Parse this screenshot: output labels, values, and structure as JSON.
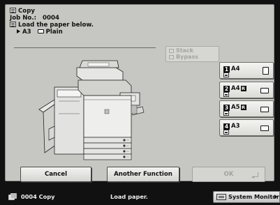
{
  "header": {
    "mode": "Copy",
    "job_label": "Job No.:",
    "job_number": "0004",
    "instruction": "Load the paper below.",
    "paper_size": "A3",
    "paper_type": "Plain"
  },
  "stack_bypass": {
    "line1": "Stack",
    "line2": "Bypass"
  },
  "trays": [
    {
      "number": "1",
      "size": "A4",
      "rotated": false,
      "orientation": "portrait"
    },
    {
      "number": "2",
      "size": "A4",
      "rotated": true,
      "rotated_mark": "R",
      "orientation": "landscape"
    },
    {
      "number": "3",
      "size": "A5",
      "rotated": true,
      "rotated_mark": "R",
      "orientation": "landscape"
    },
    {
      "number": "4",
      "size": "A3",
      "rotated": false,
      "orientation": "landscape"
    }
  ],
  "buttons": {
    "cancel": "Cancel",
    "another_function": "Another Function",
    "ok": "OK"
  },
  "status_bar": {
    "job": "0004  Copy",
    "message": "Load paper.",
    "system_monitor": "System Monitor"
  },
  "icons": {
    "header_mode": "copy-icon",
    "instruction": "paper-load-icon",
    "selected_indicator": "triangle-pointer-icon",
    "paper_type": "paper-icon",
    "status_copy": "copy-icon",
    "system_monitor": "monitor-icon"
  },
  "colors": {
    "panel_bg": "#c6c6c2",
    "status_bg": "#111111",
    "disabled_text": "#a4a4a0"
  }
}
